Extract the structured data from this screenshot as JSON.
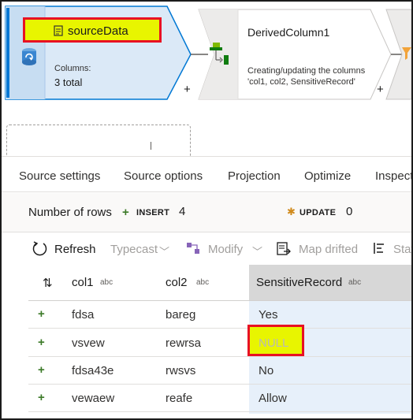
{
  "pipeline": {
    "source_node": {
      "name": "sourceData",
      "columns_label": "Columns:",
      "columns_value": "3 total"
    },
    "derived_node": {
      "name": "DerivedColumn1",
      "description_line1": "Creating/updating the columns",
      "description_line2": "'col1, col2, SensitiveRecord'"
    },
    "add_label": "+"
  },
  "tabs": [
    "Source settings",
    "Source options",
    "Projection",
    "Optimize",
    "Inspect"
  ],
  "summary": {
    "rows_label": "Number of rows",
    "insert_label": "INSERT",
    "insert_count": "4",
    "update_label": "UPDATE",
    "update_count": "0"
  },
  "toolbar": {
    "refresh": "Refresh",
    "typecast": "Typecast",
    "modify": "Modify",
    "map_drifted": "Map drifted",
    "stats": "Stats"
  },
  "table": {
    "columns": [
      {
        "name": "col1",
        "type": "abc"
      },
      {
        "name": "col2",
        "type": "abc"
      },
      {
        "name": "SensitiveRecord",
        "type": "abc"
      }
    ],
    "rows": [
      {
        "mark": "+",
        "col1": "fdsa",
        "col2": "bareg",
        "sensitive": "Yes"
      },
      {
        "mark": "+",
        "col1": "vsvew",
        "col2": "rewrsa",
        "sensitive": "NULL"
      },
      {
        "mark": "+",
        "col1": "fdsa43e",
        "col2": "rwsvs",
        "sensitive": "No"
      },
      {
        "mark": "+",
        "col1": "vewaew",
        "col2": "reafe",
        "sensitive": "Allow"
      }
    ]
  },
  "colors": {
    "accent_blue": "#0078d4",
    "highlight_red": "#e81123",
    "highlight_yellow": "#e8f500",
    "insert_green": "#3c7a28",
    "update_orange": "#d08a1c"
  }
}
